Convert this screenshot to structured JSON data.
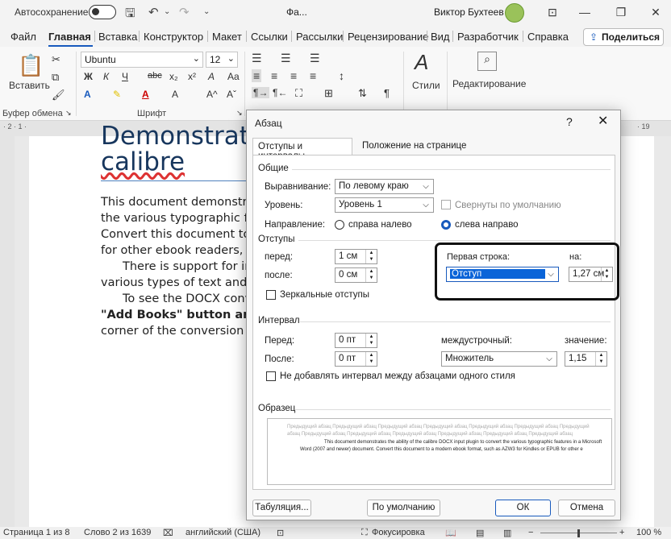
{
  "titlebar": {
    "autosave_label": "Автосохранение",
    "doc_name": "Фа...",
    "user_name": "Виктор Бухтеев",
    "minimize_icon": "—",
    "restore_icon": "❐",
    "close_icon": "✕",
    "ribbon_display_icon": "⊡"
  },
  "menubar": {
    "items": [
      "Файл",
      "Главная",
      "Вставка",
      "Конструктор",
      "Макет",
      "Ссылки",
      "Рассылки",
      "Рецензирование",
      "Вид",
      "Разработчик",
      "Справка"
    ],
    "share_label": "Поделиться"
  },
  "ribbon": {
    "paste_label": "Вставить",
    "clipboard_group": "Буфер обмена",
    "font_name": "Ubuntu",
    "font_size": "12",
    "font_group": "Шрифт",
    "styles_label": "Стили",
    "editing_label": "Редактирование",
    "bold": "Ж",
    "italic": "К",
    "underline": "Ч",
    "strike": "abc",
    "subscript": "x₂",
    "superscript": "x²",
    "clear": "A",
    "grow_font": "A^",
    "shrink_font": "Aˇ",
    "change_case": "Aa",
    "pilcrow": "¶"
  },
  "ruler": {
    "left_mark": "· 2 · 1 · ",
    "right_mark": "· 19"
  },
  "document": {
    "title_partial": "Demonstrati",
    "title_line2": "calibre",
    "lines": [
      "This document demonstra",
      "the various typographic fe",
      "Convert this document to",
      "for other ebook readers, t",
      "There is support for im",
      "various types of text and p",
      "To see the DOCX conv",
      "\"Add Books\" button and t",
      "corner of the conversion d"
    ]
  },
  "statusbar": {
    "page": "Страница 1 из 8",
    "words": "Слово 2 из 1639",
    "language": "английский (США)",
    "focus": "Фокусировка",
    "zoom": "100 %",
    "zoom_minus": "−",
    "zoom_plus": "+"
  },
  "dialog": {
    "title": "Абзац",
    "help": "?",
    "close": "✕",
    "tabs": [
      "Отступы и интервалы",
      "Положение на странице"
    ],
    "general": {
      "section": "Общие",
      "alignment_label": "Выравнивание:",
      "alignment_value": "По левому краю",
      "level_label": "Уровень:",
      "level_value": "Уровень 1",
      "collapsed_label": "Свернуты по умолчанию",
      "direction_label": "Направление:",
      "rtl_label": "справа налево",
      "ltr_label": "слева направо"
    },
    "indent": {
      "section": "Отступы",
      "before_label": "перед:",
      "before_value": "1 см",
      "after_label": "после:",
      "after_value": "0 см",
      "mirror_label": "Зеркальные отступы",
      "first_line_label": "Первая строка:",
      "first_line_value": "Отступ",
      "by_label": "на:",
      "by_value": "1,27 см"
    },
    "spacing": {
      "section": "Интервал",
      "before_label": "Перед:",
      "before_value": "0 пт",
      "after_label": "После:",
      "after_value": "0 пт",
      "line_label": "междустрочный:",
      "line_value": "Множитель",
      "value_label": "значение:",
      "value_value": "1,15",
      "no_space_label": "Не добавлять интервал между абзацами одного стиля"
    },
    "preview": {
      "section": "Образец",
      "prev_text": "Предыдущий абзац Предыдущий абзац Предыдущий абзац Предыдущий абзац Предыдущий абзац Предыдущий абзац Предыдущий абзац Предыдущий абзац Предыдущий абзац Предыдущий абзац Предыдущий абзац Предыдущий абзац Предыдущий абзац",
      "current_text": "This document demonstrates the ability of the calibre DOCX input plugin to convert the various typographic features in a Microsoft Word (2007 and newer) document. Convert this document to a modern ebook format, such as AZW3 for Kindles or EPUB for other e"
    },
    "buttons": {
      "tabs": "Табуляция...",
      "default": "По умолчанию",
      "ok": "ОК",
      "cancel": "Отмена"
    }
  }
}
